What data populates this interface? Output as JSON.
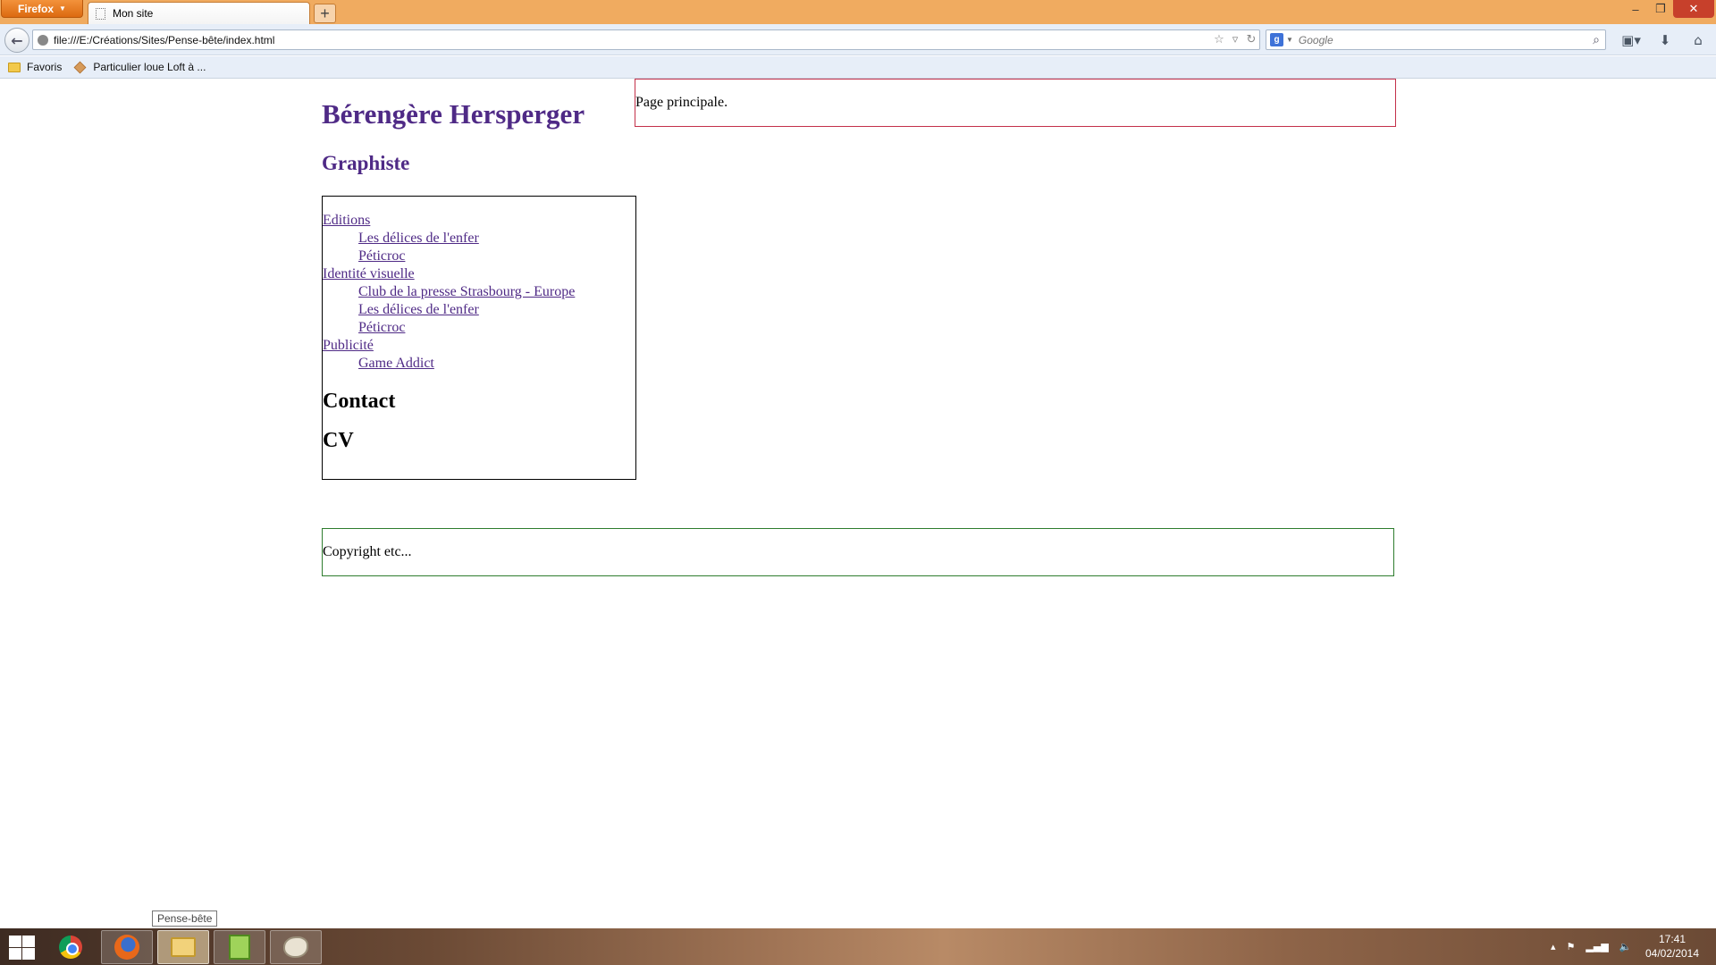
{
  "browser": {
    "menu_button": "Firefox",
    "tab_title": "Mon site",
    "new_tab": "+",
    "url": "file:///E:/Créations/Sites/Pense-bête/index.html",
    "search_placeholder": "Google",
    "bookmarks": [
      "Favoris",
      "Particulier loue Loft à ..."
    ]
  },
  "site": {
    "title": "Bérengère Hersperger",
    "subtitle": "Graphiste",
    "main_text": "Page principale.",
    "nav": {
      "editions": "Editions",
      "editions_items": [
        "Les délices de l'enfer",
        "Péticroc"
      ],
      "identite": "Identité visuelle",
      "identite_items": [
        "Club de la presse Strasbourg - Europe",
        "Les délices de l'enfer",
        "Péticroc"
      ],
      "publicite": "Publicité",
      "publicite_items": [
        "Game Addict"
      ],
      "contact": "Contact",
      "cv": "CV"
    },
    "footer": "Copyright etc..."
  },
  "taskbar": {
    "tooltip": "Pense-bête",
    "apps": [
      "chrome-icon",
      "firefox-icon",
      "explorer-icon",
      "notes-icon",
      "paint-icon"
    ],
    "time": "17:41",
    "date": "04/02/2014"
  },
  "colors": {
    "link": "#4f2a86",
    "main_border": "#c3304a",
    "footer_border": "#2e7d2e",
    "titlebar": "#f0ab60"
  }
}
